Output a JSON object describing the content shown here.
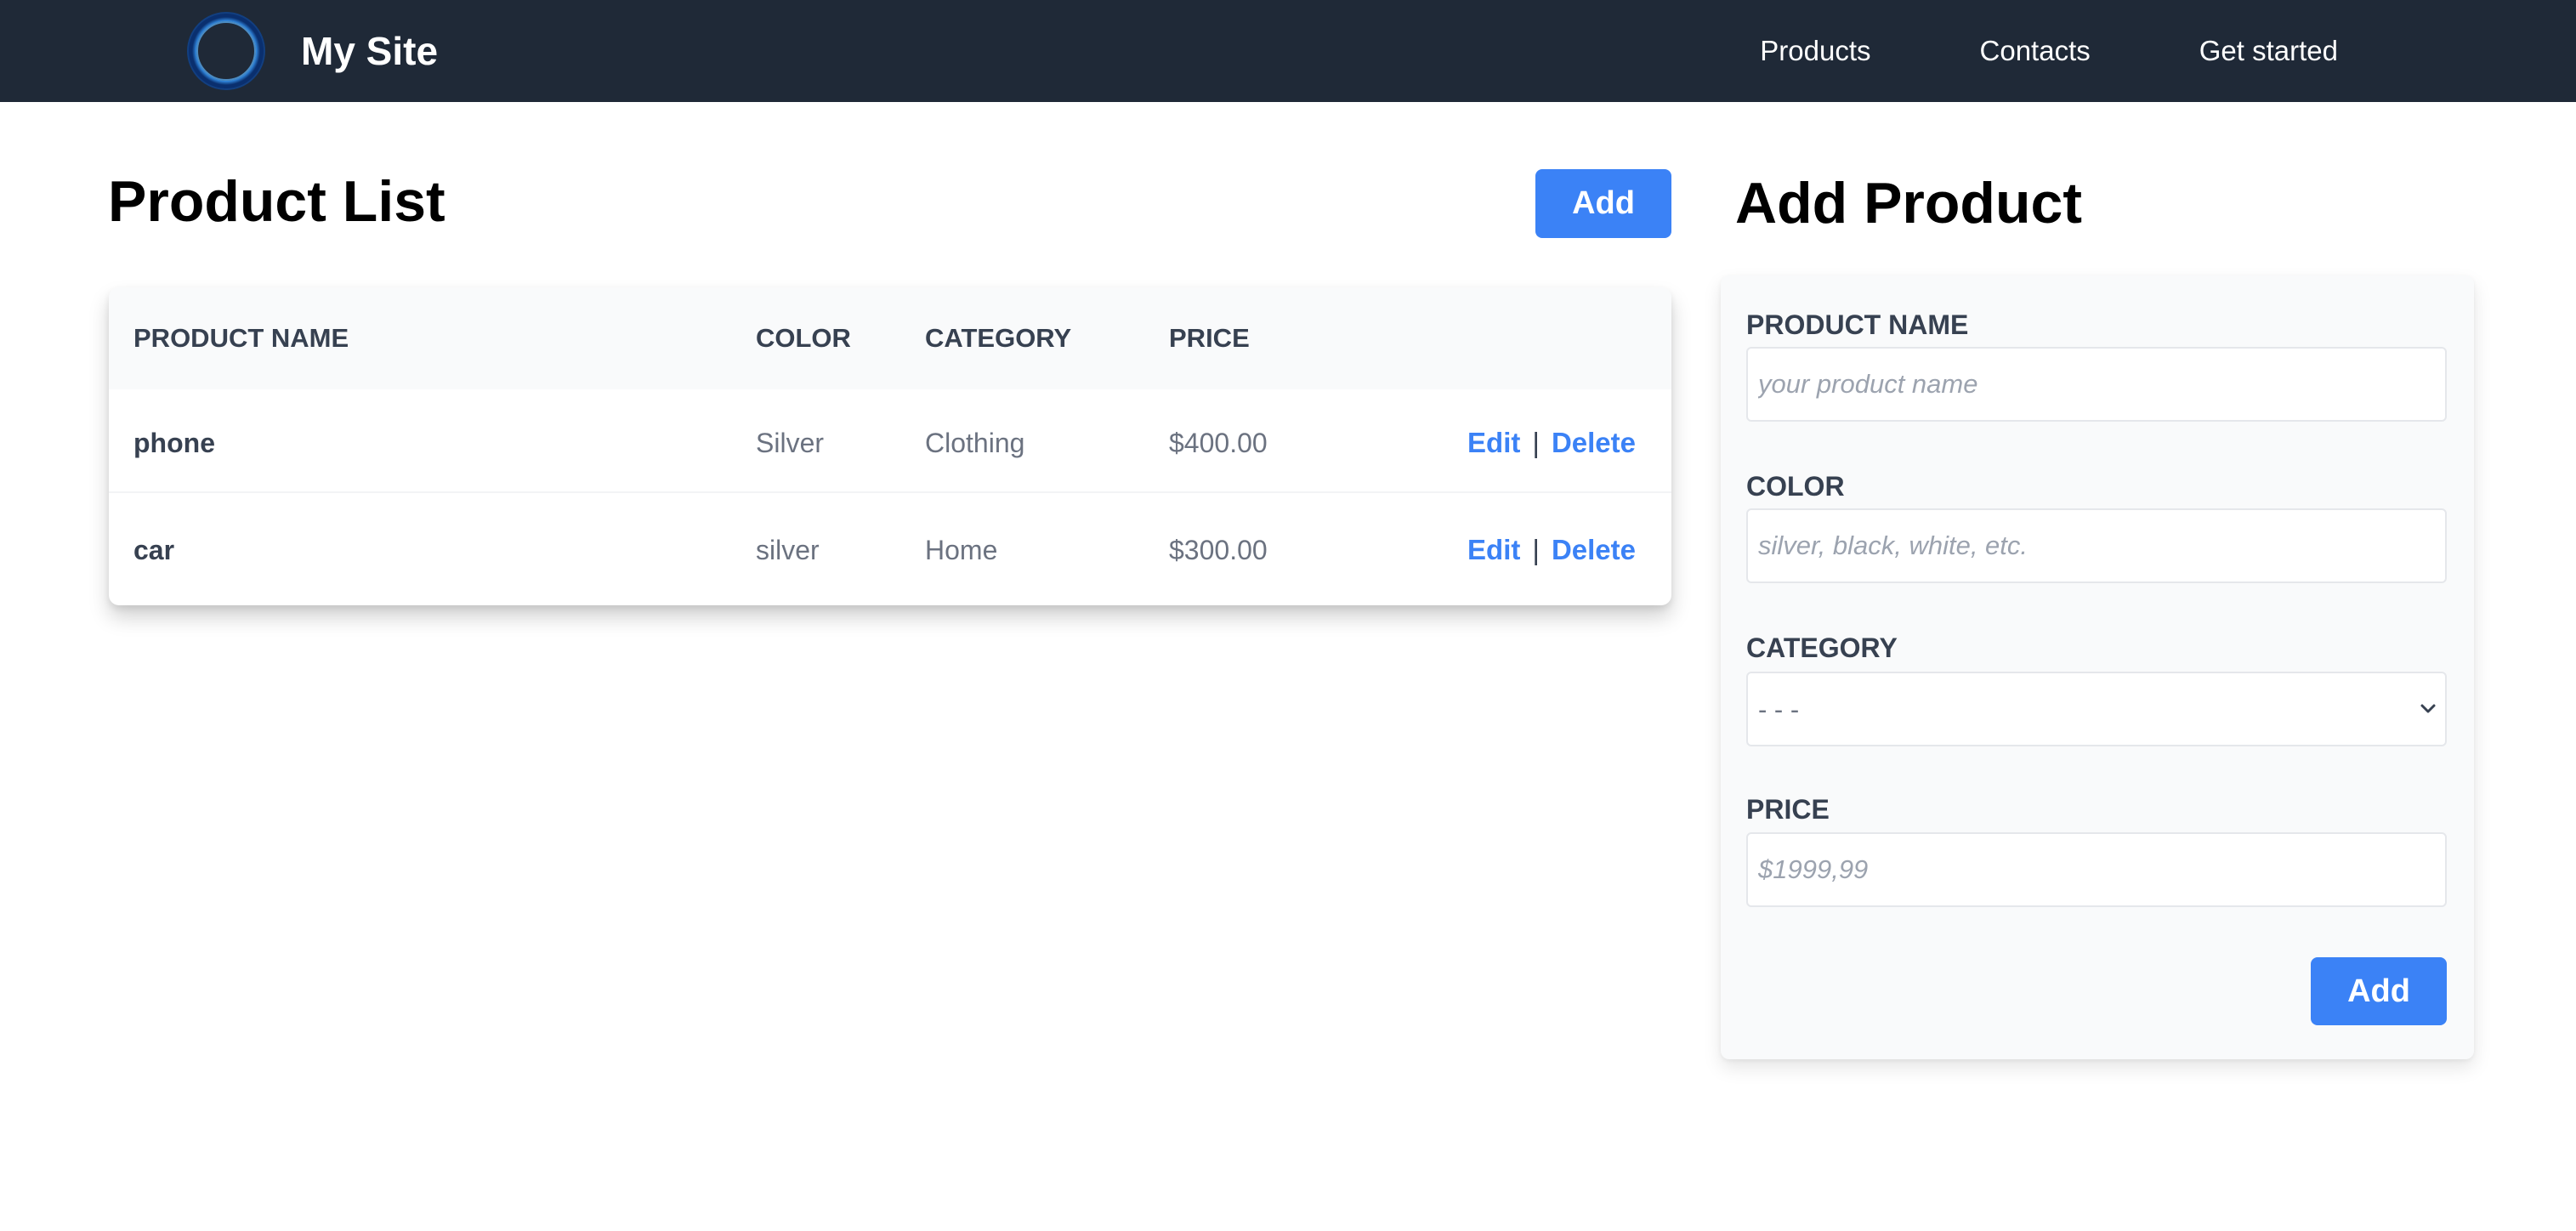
{
  "nav": {
    "brand": "My Site",
    "logo_icon": "ring-logo-icon",
    "links": [
      "Products",
      "Contacts",
      "Get started"
    ]
  },
  "product_list": {
    "title": "Product List",
    "add_label": "Add",
    "columns": [
      "Product Name",
      "Color",
      "Category",
      "Price"
    ],
    "rows": [
      {
        "name": "phone",
        "color": "Silver",
        "category": "Clothing",
        "price": "$400.00",
        "edit": "Edit",
        "separator": "|",
        "delete": "Delete"
      },
      {
        "name": "car",
        "color": "silver",
        "category": "Home",
        "price": "$300.00",
        "edit": "Edit",
        "separator": "|",
        "delete": "Delete"
      }
    ]
  },
  "add_product": {
    "title": "Add Product",
    "fields": {
      "name": {
        "label": "PRODUCT NAME",
        "placeholder": "your product name",
        "value": ""
      },
      "color": {
        "label": "COLOR",
        "placeholder": "silver, black, white, etc.",
        "value": ""
      },
      "category": {
        "label": "CATEGORY",
        "selected": "- - -"
      },
      "price": {
        "label": "PRICE",
        "placeholder": "$1999,99",
        "value": ""
      }
    },
    "submit_label": "Add"
  },
  "colors": {
    "navbar": "#1f2937",
    "accent": "#3b82f6",
    "logo_blue": "#1d6fe0"
  }
}
